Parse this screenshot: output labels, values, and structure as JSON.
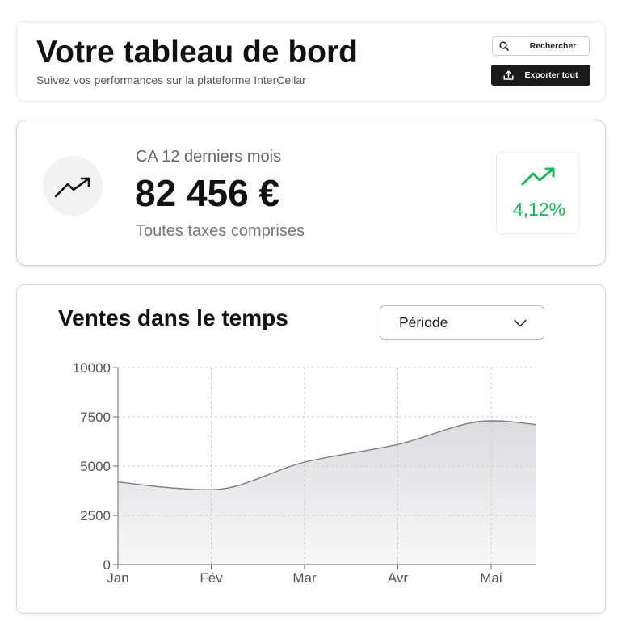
{
  "header": {
    "title": "Votre tableau de bord",
    "subtitle": "Suivez vos performances sur la plateforme InterCellar",
    "search": {
      "label": "Rechercher",
      "icon": "search-icon"
    },
    "export": {
      "label": "Exporter tout",
      "icon": "upload-icon"
    }
  },
  "kpi": {
    "icon": "trending-up-icon",
    "label": "CA 12 derniers mois",
    "value": "82 456 €",
    "note": "Toutes taxes comprises",
    "change": {
      "value": "4,12%",
      "icon": "trending-up-icon",
      "color": "#1fb35a"
    }
  },
  "sales": {
    "period_select": {
      "selected": "Période",
      "icon": "chevron-down-icon"
    }
  },
  "colors": {
    "positive": "#1fb35a",
    "primary_button": "#1a1a1a",
    "chart_line": "#7f7f7f",
    "chart_fill": "#dadade"
  },
  "chart_data": {
    "type": "area",
    "title": "Ventes dans le temps",
    "xlabel": "",
    "ylabel": "",
    "categories": [
      "Jan",
      "Fév",
      "Mar",
      "Avr",
      "Mai"
    ],
    "values": [
      4200,
      3800,
      5200,
      6100,
      7300
    ],
    "value_at_plot_right_edge": 7100,
    "ylim": [
      0,
      10000
    ],
    "y_ticks": [
      0,
      2500,
      5000,
      7500,
      10000
    ],
    "grid": true,
    "legend": "none",
    "curve": "smooth"
  }
}
